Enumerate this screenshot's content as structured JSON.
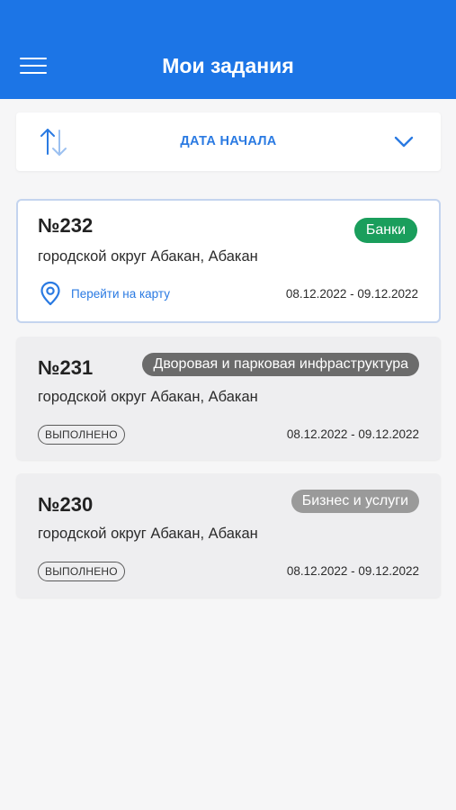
{
  "header": {
    "title": "Мои задания",
    "background_color": "#1c75e6"
  },
  "sort": {
    "label": "ДАТА НАЧАЛА",
    "accent_color": "#2a7ae2"
  },
  "tasks": [
    {
      "number": "№232",
      "address": "городской округ Абакан, Абакан",
      "category": "Банки",
      "category_color": "#1a9e5c",
      "map_link": "Перейти на карту",
      "dates": "08.12.2022 - 09.12.2022",
      "active": true
    },
    {
      "number": "№231",
      "address": "городской округ Абакан, Абакан",
      "category": "Дворовая и парковая инфраструктура",
      "category_color": "#6b6b6b",
      "status": "ВЫПОЛНЕНО",
      "dates": "08.12.2022 - 09.12.2022",
      "active": false
    },
    {
      "number": "№230",
      "address": "городской округ Абакан, Абакан",
      "category": "Бизнес и услуги",
      "category_color": "#9a9a9a",
      "status": "ВЫПОЛНЕНО",
      "dates": "08.12.2022 - 09.12.2022",
      "active": false
    }
  ]
}
